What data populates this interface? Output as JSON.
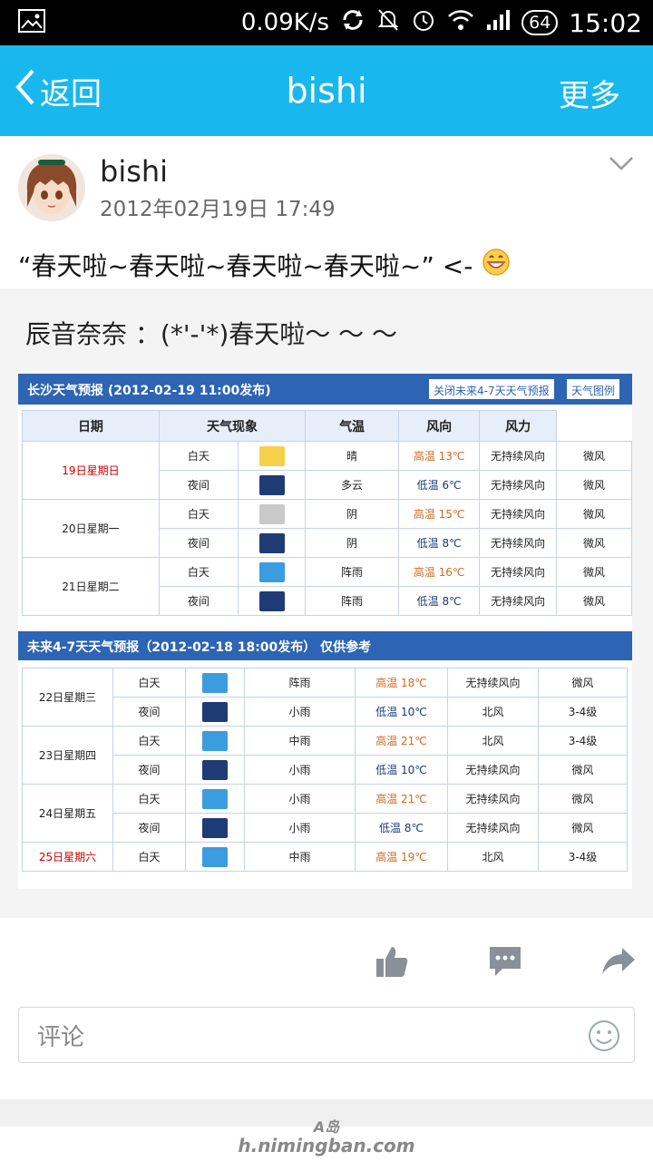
{
  "status_bar": {
    "speed": "0.09K/s",
    "battery": "64",
    "time": "15:02"
  },
  "app_bar": {
    "back_label": "返回",
    "title": "bishi",
    "more_label": "更多"
  },
  "post": {
    "author": "bishi",
    "time": "2012年02月19日 17:49",
    "text": "“春天啦~春天啦~春天啦~春天啦~” <-"
  },
  "quote": {
    "title": "辰音奈奈 ：(*'-'*)春天啦～ ～ ～"
  },
  "weather": {
    "header": "长沙天气预报 (2012-02-19  11:00发布)",
    "btn_future": "关闭未来4-7天天气预报",
    "btn_map": "天气图例",
    "columns": [
      "日期",
      "天气现象",
      "气温",
      "风向",
      "风力"
    ],
    "section2": "未来4-7天天气预报（2012-02-18 18:00发布）    仅供参考",
    "days1": [
      {
        "date": "19日星期日",
        "red": true,
        "rows": [
          {
            "period": "白天",
            "icon": "sun-icon",
            "desc": "晴",
            "temp": "高温 13℃",
            "hi": true,
            "wind_dir": "无持续风向",
            "wind": "微风"
          },
          {
            "period": "夜间",
            "icon": "night-cloud-icon",
            "desc": "多云",
            "temp": "低温 6℃",
            "hi": false,
            "wind_dir": "无持续风向",
            "wind": "微风"
          }
        ]
      },
      {
        "date": "20日星期一",
        "red": false,
        "rows": [
          {
            "period": "白天",
            "icon": "cloud-icon",
            "desc": "阴",
            "temp": "高温 15℃",
            "hi": true,
            "wind_dir": "无持续风向",
            "wind": "微风"
          },
          {
            "period": "夜间",
            "icon": "night-cloud-icon",
            "desc": "阴",
            "temp": "低温 8℃",
            "hi": false,
            "wind_dir": "无持续风向",
            "wind": "微风"
          }
        ]
      },
      {
        "date": "21日星期二",
        "red": false,
        "rows": [
          {
            "period": "白天",
            "icon": "shower-icon",
            "desc": "阵雨",
            "temp": "高温 16℃",
            "hi": true,
            "wind_dir": "无持续风向",
            "wind": "微风"
          },
          {
            "period": "夜间",
            "icon": "night-shower-icon",
            "desc": "阵雨",
            "temp": "低温 8℃",
            "hi": false,
            "wind_dir": "无持续风向",
            "wind": "微风"
          }
        ]
      }
    ],
    "days2": [
      {
        "date": "22日星期三",
        "red": false,
        "rows": [
          {
            "period": "白天",
            "icon": "shower-icon",
            "desc": "阵雨",
            "temp": "高温 18℃",
            "hi": true,
            "wind_dir": "无持续风向",
            "wind": "微风"
          },
          {
            "period": "夜间",
            "icon": "night-rain-icon",
            "desc": "小雨",
            "temp": "低温 10℃",
            "hi": false,
            "wind_dir": "北风",
            "wind": "3-4级"
          }
        ]
      },
      {
        "date": "23日星期四",
        "red": false,
        "rows": [
          {
            "period": "白天",
            "icon": "rain-icon",
            "desc": "中雨",
            "temp": "高温 21℃",
            "hi": true,
            "wind_dir": "北风",
            "wind": "3-4级"
          },
          {
            "period": "夜间",
            "icon": "night-rain-icon",
            "desc": "小雨",
            "temp": "低温 10℃",
            "hi": false,
            "wind_dir": "无持续风向",
            "wind": "微风"
          }
        ]
      },
      {
        "date": "24日星期五",
        "red": false,
        "rows": [
          {
            "period": "白天",
            "icon": "rain-icon",
            "desc": "小雨",
            "temp": "高温 21℃",
            "hi": true,
            "wind_dir": "无持续风向",
            "wind": "微风"
          },
          {
            "period": "夜间",
            "icon": "night-rain-icon",
            "desc": "小雨",
            "temp": "低温 8℃",
            "hi": false,
            "wind_dir": "无持续风向",
            "wind": "微风"
          }
        ]
      },
      {
        "date": "25日星期六",
        "red": true,
        "rows": [
          {
            "period": "白天",
            "icon": "rain-icon",
            "desc": "中雨",
            "temp": "高温 19℃",
            "hi": true,
            "wind_dir": "北风",
            "wind": "3-4级"
          }
        ]
      }
    ]
  },
  "comment": {
    "placeholder": "评论"
  },
  "watermark": {
    "line1": "A岛",
    "line2": "h.nimingban.com"
  },
  "colors": {
    "app_bar": "#18b8ee",
    "weather_header": "#2d64b3"
  }
}
